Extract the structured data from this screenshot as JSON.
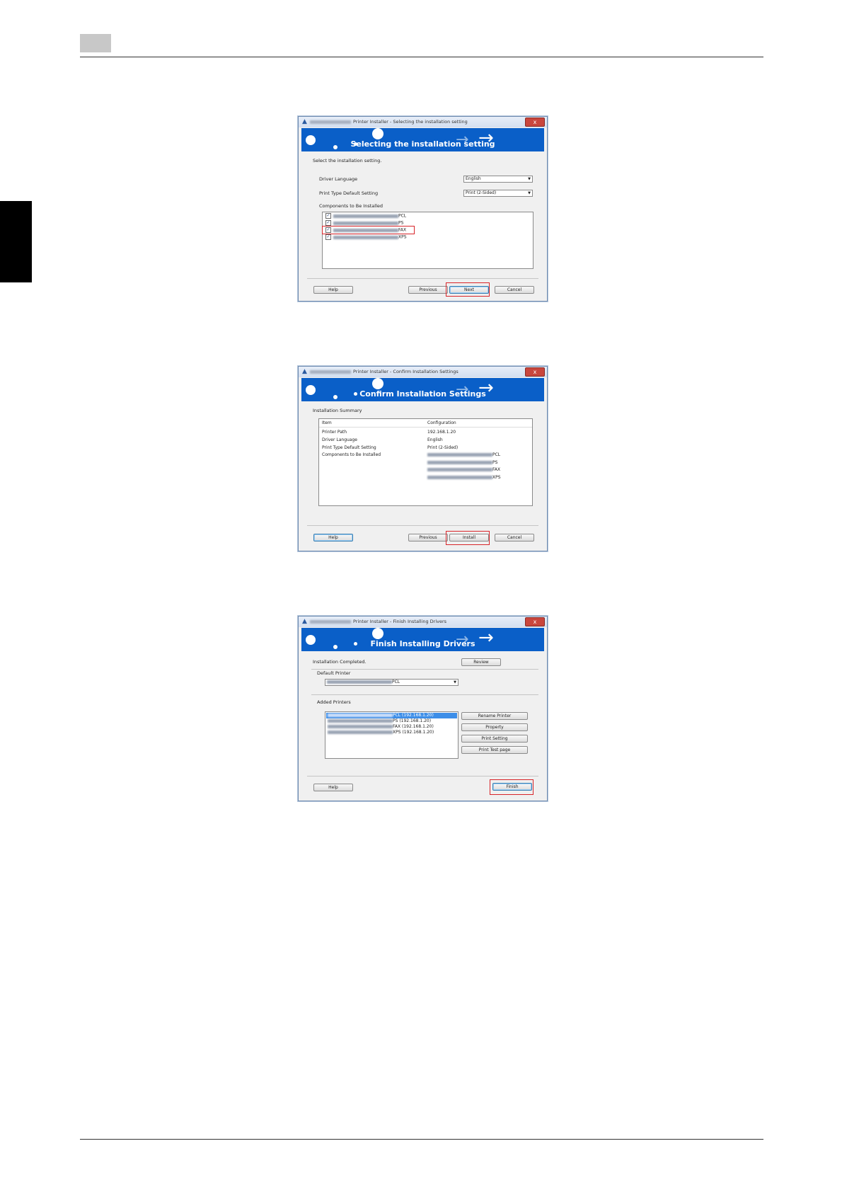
{
  "page": {
    "chapter_box": "",
    "side_tab": ""
  },
  "dialog1": {
    "title_suffix": "Printer Installer - Selecting the installation setting",
    "close": "x",
    "banner_title": "Selecting the installation setting",
    "instruction": "Select the installation setting.",
    "driver_language_label": "Driver Language",
    "driver_language_value": "English",
    "print_type_label": "Print Type Default Setting",
    "print_type_value": "Print (2-Sided)",
    "components_label": "Components to Be Installed",
    "components": [
      {
        "suffix": "PCL",
        "checked": true
      },
      {
        "suffix": "PS",
        "checked": true
      },
      {
        "suffix": "FAX",
        "checked": true
      },
      {
        "suffix": "XPS",
        "checked": true
      }
    ],
    "buttons": {
      "help": "Help",
      "previous": "Previous",
      "next": "Next",
      "cancel": "Cancel"
    }
  },
  "dialog2": {
    "title_suffix": "Printer Installer - Confirm Installation Settings",
    "close": "x",
    "banner_title": "Confirm Installation Settings",
    "summary_label": "Installation Summary",
    "col_item": "Item",
    "col_config": "Configuration",
    "rows": [
      {
        "item": "Printer Path",
        "config": "192.168.1.20"
      },
      {
        "item": "Driver Language",
        "config": "English"
      },
      {
        "item": "Print Type Default Setting",
        "config": "Print (2-Sided)"
      },
      {
        "item": "Components to Be Installed",
        "config": "PCL"
      }
    ],
    "extra_components": [
      "PS",
      "FAX",
      "XPS"
    ],
    "buttons": {
      "help": "Help",
      "previous": "Previous",
      "install": "Install",
      "cancel": "Cancel"
    }
  },
  "dialog3": {
    "title_suffix": "Printer Installer - Finish Installing Drivers",
    "close": "x",
    "banner_title": "Finish Installing Drivers",
    "completed": "Installation Completed.",
    "review": "Review",
    "default_printer_label": "Default Printer",
    "default_printer_value": "PCL",
    "added_printers_label": "Added Printers",
    "added_printers": [
      "PCL (192.168.1.20)",
      "PS (192.168.1.20)",
      "FAX (192.168.1.20)",
      "XPS (192.168.1.20)"
    ],
    "side_buttons": {
      "rename": "Rename Printer",
      "property": "Property",
      "print_setting": "Print Setting",
      "print_test": "Print Test page"
    },
    "buttons": {
      "help": "Help",
      "finish": "Finish"
    }
  },
  "colors": {
    "banner": "#0a5fc8",
    "highlight": "#d8252a",
    "selection": "#3d8ee8"
  }
}
